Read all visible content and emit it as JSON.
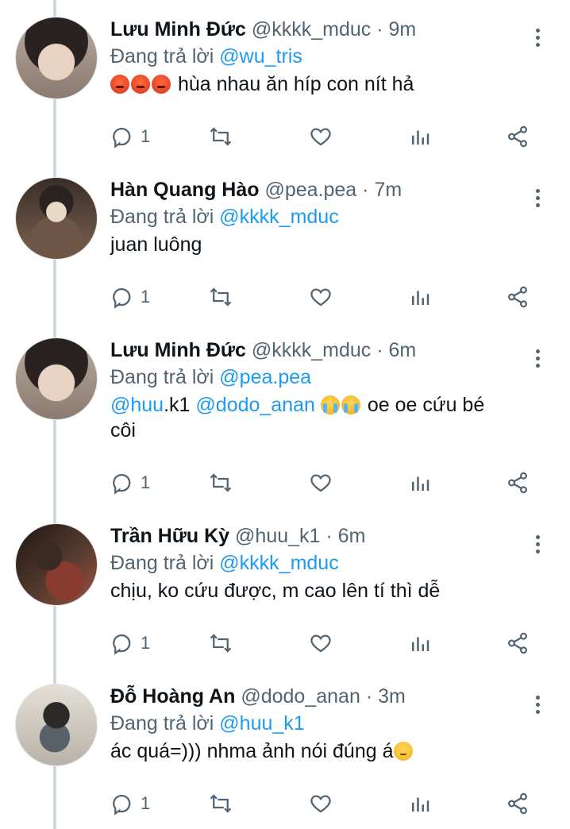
{
  "tweets": [
    {
      "name": "Lưu Minh Đức",
      "handle": "@kkkk_mduc",
      "separator": "·",
      "time": "9m",
      "reply_prefix": "Đang trả lời",
      "reply_to": "@wu_tris",
      "body_text": "hùa nhau ăn híp con nít hả",
      "emoji": [
        "angry-face",
        "angry-face",
        "angry-face"
      ],
      "reply_count": "1"
    },
    {
      "name": "Hàn Quang Hào",
      "handle": "@pea.pea",
      "separator": "·",
      "time": "7m",
      "reply_prefix": "Đang trả lời",
      "reply_to": "@kkkk_mduc",
      "body_text": "juan luông",
      "reply_count": "1"
    },
    {
      "name": "Lưu Minh Đức",
      "handle": "@kkkk_mduc",
      "separator": "·",
      "time": "6m",
      "reply_prefix": "Đang trả lời",
      "reply_to": "@pea.pea",
      "body_mention_1": "@huu",
      "body_mention_1_rest": ".k1",
      "body_mention_2": "@dodo_anan",
      "body_text_1": "oe oe cứu bé",
      "body_text_2": "côi",
      "emoji": [
        "crying-face",
        "crying-face"
      ],
      "reply_count": "1"
    },
    {
      "name": "Trần Hữu Kỳ",
      "handle": "@huu_k1",
      "separator": "·",
      "time": "6m",
      "reply_prefix": "Đang trả lời",
      "reply_to": "@kkkk_mduc",
      "body_text": "chịu, ko cứu được, m cao lên tí thì dễ",
      "reply_count": "1"
    },
    {
      "name": "Đỗ Hoàng An",
      "handle": "@dodo_anan",
      "separator": "·",
      "time": "3m",
      "reply_prefix": "Đang trả lời",
      "reply_to": "@huu_k1",
      "body_text": "ác quá=))) nhma ảnh nói đúng á",
      "emoji": [
        "pensive-face"
      ],
      "reply_count": "1"
    }
  ],
  "colors": {
    "text": "#0f1419",
    "secondary": "#536471",
    "mention": "#1d9bf0",
    "thread_line": "#cfd9de"
  },
  "icons": [
    "reply-icon",
    "retweet-icon",
    "like-icon",
    "views-icon",
    "share-icon",
    "more-icon"
  ]
}
